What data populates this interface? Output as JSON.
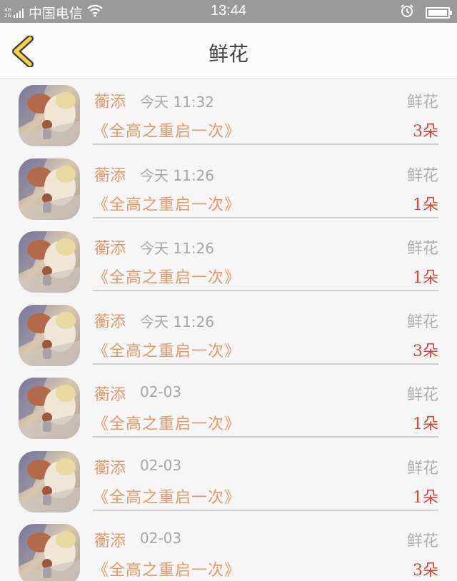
{
  "status_bar": {
    "network_top": "4G",
    "network_bottom": "2G",
    "carrier": "中国电信",
    "time": "13:44"
  },
  "nav": {
    "title": "鲜花"
  },
  "items": [
    {
      "name": "蘅添",
      "time": "今天 11:32",
      "gift_type": "鲜花",
      "book_title": "《全高之重启一次》",
      "count": "3朵"
    },
    {
      "name": "蘅添",
      "time": "今天 11:26",
      "gift_type": "鲜花",
      "book_title": "《全高之重启一次》",
      "count": "1朵"
    },
    {
      "name": "蘅添",
      "time": "今天 11:26",
      "gift_type": "鲜花",
      "book_title": "《全高之重启一次》",
      "count": "1朵"
    },
    {
      "name": "蘅添",
      "time": "今天 11:26",
      "gift_type": "鲜花",
      "book_title": "《全高之重启一次》",
      "count": "3朵"
    },
    {
      "name": "蘅添",
      "time": "02-03",
      "gift_type": "鲜花",
      "book_title": "《全高之重启一次》",
      "count": "1朵"
    },
    {
      "name": "蘅添",
      "time": "02-03",
      "gift_type": "鲜花",
      "book_title": "《全高之重启一次》",
      "count": "1朵"
    },
    {
      "name": "蘅添",
      "time": "02-03",
      "gift_type": "鲜花",
      "book_title": "《全高之重启一次》",
      "count": "3朵"
    }
  ],
  "icons": {
    "back": "chevron-left-icon",
    "wifi": "wifi-icon",
    "alarm": "alarm-icon",
    "battery": "battery-icon",
    "signal": "signal-icon"
  },
  "colors": {
    "accent": "#e39a6e",
    "count": "#d9433a",
    "back_arrow_fill": "#f3d34a",
    "back_arrow_stroke": "#3d3d3d"
  }
}
